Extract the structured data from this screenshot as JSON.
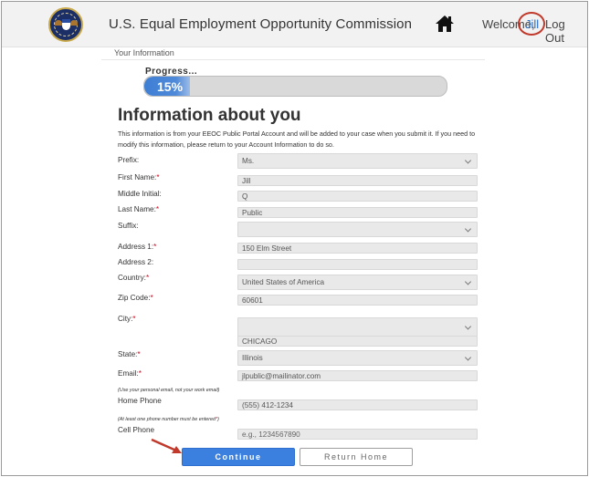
{
  "header": {
    "agency_name": "U.S. Equal Employment Opportunity Commission",
    "welcome_text": "Welcome,",
    "user_name": "Jill",
    "logout_label": "Log Out"
  },
  "breadcrumb": "Your Information",
  "progress": {
    "label": "Progress...",
    "value_text": "15%",
    "value": 0.15
  },
  "section": {
    "title": "Information about you",
    "intro": "This information is from your EEOC Public Portal Account and will be added to your case when you submit it. If you need to modify this information, please return to your Account Information to do so."
  },
  "form": {
    "prefix": {
      "label": "Prefix:",
      "value": "Ms."
    },
    "first_name": {
      "label": "First Name:",
      "value": "Jill"
    },
    "middle_initial": {
      "label": "Middle Initial:",
      "value": "Q"
    },
    "last_name": {
      "label": "Last Name:",
      "value": "Public"
    },
    "suffix": {
      "label": "Suffix:",
      "value": ""
    },
    "address1": {
      "label": "Address 1:",
      "value": "150 Elm Street"
    },
    "address2": {
      "label": "Address 2:",
      "value": ""
    },
    "country": {
      "label": "Country:",
      "value": "United States of America"
    },
    "zip": {
      "label": "Zip Code:",
      "value": "60601"
    },
    "city": {
      "label": "City:",
      "value": "",
      "text_value": "CHICAGO"
    },
    "state": {
      "label": "State:",
      "value": "Illinois"
    },
    "email": {
      "label": "Email:",
      "value": "jlpublic@mailinator.com",
      "hint": "(Use your personal email, not your work email)"
    },
    "home_phone": {
      "label": "Home Phone",
      "value": "(555) 412-1234",
      "hint": "(At least one phone number must be entered"
    },
    "cell_phone": {
      "label": "Cell Phone",
      "placeholder": "e.g., 1234567890"
    },
    "required_marker": "*"
  },
  "buttons": {
    "continue_label": "Continue",
    "return_label": "Return Home"
  },
  "colors": {
    "accent": "#3b7fdf",
    "required": "#d0021b",
    "annotation": "#c0392b"
  }
}
